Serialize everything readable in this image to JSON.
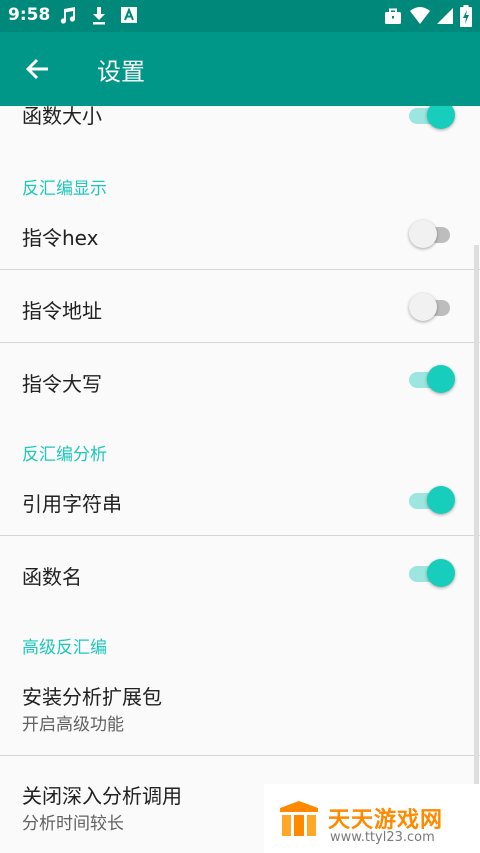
{
  "status_bar": {
    "time": "9:58",
    "left_icons": [
      "music-note-icon",
      "download-icon",
      "a-letter-icon"
    ],
    "right_icons": [
      "briefcase-icon",
      "wifi-icon",
      "signal-icon",
      "battery-charging-icon"
    ]
  },
  "toolbar": {
    "back_icon": "arrow-back-icon",
    "title": "设置",
    "color": "#009688"
  },
  "settings": {
    "partial_item": {
      "label": "函数大小",
      "checked": true
    },
    "sections": [
      {
        "header": "反汇编显示",
        "items": [
          {
            "label": "指令hex",
            "checked": false
          },
          {
            "label": "指令地址",
            "checked": false
          },
          {
            "label": "指令大写",
            "checked": true
          }
        ]
      },
      {
        "header": "反汇编分析",
        "items": [
          {
            "label": "引用字符串",
            "checked": true
          },
          {
            "label": "函数名",
            "checked": true
          }
        ]
      },
      {
        "header": "高级反汇编",
        "items": [
          {
            "label": "安装分析扩展包",
            "summary": "开启高级功能"
          },
          {
            "label": "关闭深入分析调用",
            "summary": "分析时间较长"
          }
        ]
      }
    ]
  },
  "watermark": {
    "name": "天天游戏网",
    "url": "www.ttyl23.com"
  },
  "colors": {
    "accent": "#1ec8bb",
    "switch_on": "#17cdbc",
    "switch_off": "#f1f1f1"
  }
}
